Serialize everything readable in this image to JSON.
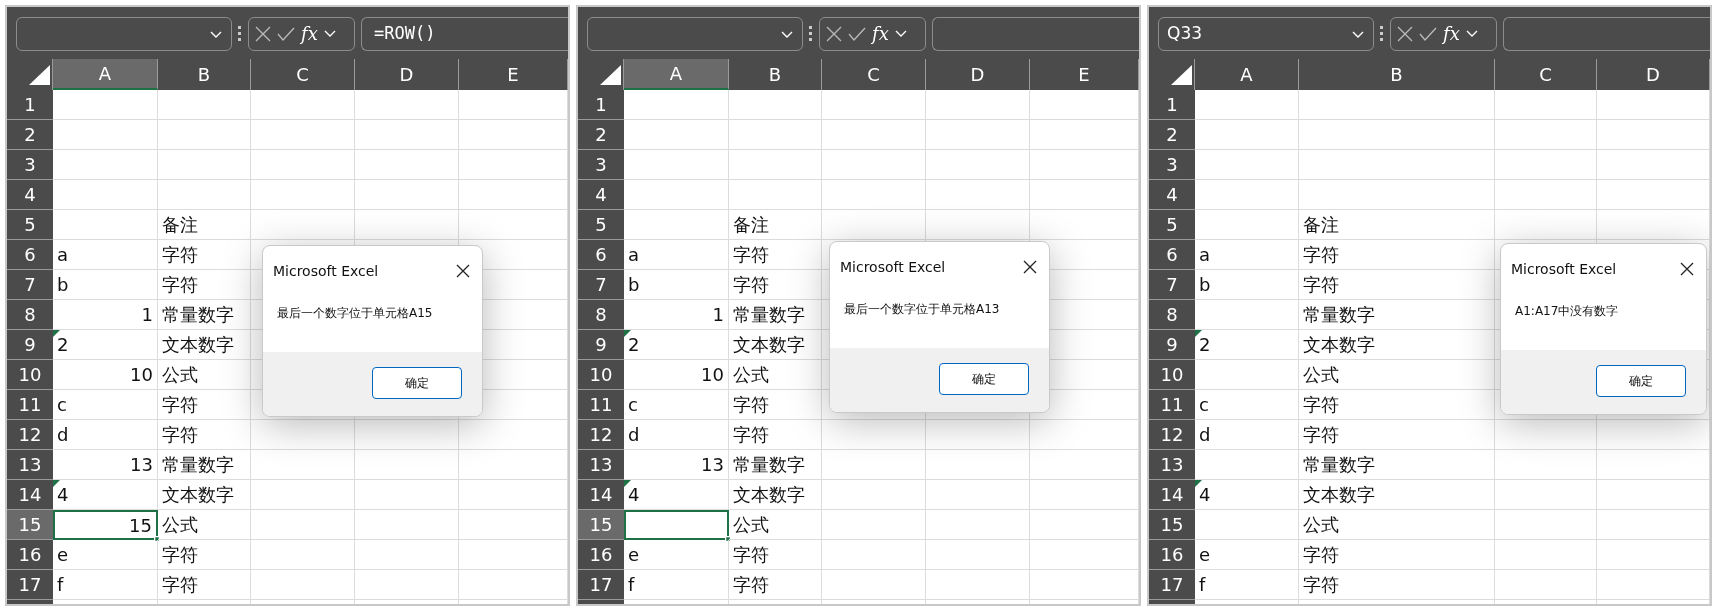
{
  "panels": [
    {
      "formula_bar": {
        "function_label": "fx",
        "formula": "=ROW()"
      },
      "columns": [
        {
          "label": "A",
          "selected": true
        },
        {
          "label": "B",
          "selected": false
        },
        {
          "label": "C",
          "selected": false
        },
        {
          "label": "D",
          "selected": false
        },
        {
          "label": "E",
          "selected": false
        }
      ],
      "rows": [
        {
          "label": "1",
          "selected": false
        },
        {
          "label": "2",
          "selected": false
        },
        {
          "label": "3",
          "selected": false
        },
        {
          "label": "4",
          "selected": false
        },
        {
          "label": "5",
          "selected": false,
          "cells": [
            {
              "selected": false
            },
            {
              "text": "备注",
              "kind": "text",
              "flagged": false,
              "selected": false
            }
          ]
        },
        {
          "label": "6",
          "selected": false,
          "cells": [
            {
              "text": "a",
              "kind": "text",
              "flagged": false,
              "selected": false
            },
            {
              "text": "字符",
              "kind": "text",
              "flagged": false,
              "selected": false
            }
          ]
        },
        {
          "label": "7",
          "selected": false,
          "cells": [
            {
              "text": "b",
              "kind": "text",
              "flagged": false,
              "selected": false
            },
            {
              "text": "字符",
              "kind": "text",
              "flagged": false,
              "selected": false
            }
          ]
        },
        {
          "label": "8",
          "selected": false,
          "cells": [
            {
              "text": "1",
              "kind": "number",
              "flagged": false,
              "selected": false
            },
            {
              "text": "常量数字",
              "kind": "text",
              "flagged": false,
              "selected": false
            }
          ]
        },
        {
          "label": "9",
          "selected": false,
          "cells": [
            {
              "text": "2",
              "kind": "text",
              "flagged": true,
              "selected": false
            },
            {
              "text": "文本数字",
              "kind": "text",
              "flagged": false,
              "selected": false
            }
          ]
        },
        {
          "label": "10",
          "selected": false,
          "cells": [
            {
              "text": "10",
              "kind": "number",
              "flagged": false,
              "selected": false
            },
            {
              "text": "公式",
              "kind": "text",
              "flagged": false,
              "selected": false
            }
          ]
        },
        {
          "label": "11",
          "selected": false,
          "cells": [
            {
              "text": "c",
              "kind": "text",
              "flagged": false,
              "selected": false
            },
            {
              "text": "字符",
              "kind": "text",
              "flagged": false,
              "selected": false
            }
          ]
        },
        {
          "label": "12",
          "selected": false,
          "cells": [
            {
              "text": "d",
              "kind": "text",
              "flagged": false,
              "selected": false
            },
            {
              "text": "字符",
              "kind": "text",
              "flagged": false,
              "selected": false
            }
          ]
        },
        {
          "label": "13",
          "selected": false,
          "cells": [
            {
              "text": "13",
              "kind": "number",
              "flagged": false,
              "selected": false
            },
            {
              "text": "常量数字",
              "kind": "text",
              "flagged": false,
              "selected": false
            }
          ]
        },
        {
          "label": "14",
          "selected": false,
          "cells": [
            {
              "text": "4",
              "kind": "text",
              "flagged": true,
              "selected": false
            },
            {
              "text": "文本数字",
              "kind": "text",
              "flagged": false,
              "selected": false
            }
          ]
        },
        {
          "label": "15",
          "selected": true,
          "cells": [
            {
              "text": "15",
              "kind": "number",
              "flagged": false,
              "selected": true
            },
            {
              "text": "公式",
              "kind": "text",
              "flagged": false,
              "selected": false
            }
          ]
        },
        {
          "label": "16",
          "selected": false,
          "cells": [
            {
              "text": "e",
              "kind": "text",
              "flagged": false,
              "selected": false
            },
            {
              "text": "字符",
              "kind": "text",
              "flagged": false,
              "selected": false
            }
          ]
        },
        {
          "label": "17",
          "selected": false,
          "cells": [
            {
              "text": "f",
              "kind": "text",
              "flagged": false,
              "selected": false
            },
            {
              "text": "字符",
              "kind": "text",
              "flagged": false,
              "selected": false
            }
          ]
        }
      ],
      "dialog": {
        "title": "Microsoft Excel",
        "message": "最后一个数字位于单元格A15",
        "button": "确定"
      }
    },
    {
      "formula_bar": {
        "function_label": "fx"
      },
      "columns": [
        {
          "label": "A",
          "selected": true
        },
        {
          "label": "B",
          "selected": false
        },
        {
          "label": "C",
          "selected": false
        },
        {
          "label": "D",
          "selected": false
        },
        {
          "label": "E",
          "selected": false
        }
      ],
      "rows": [
        {
          "label": "1",
          "selected": false
        },
        {
          "label": "2",
          "selected": false
        },
        {
          "label": "3",
          "selected": false
        },
        {
          "label": "4",
          "selected": false
        },
        {
          "label": "5",
          "selected": false,
          "cells": [
            {
              "selected": false
            },
            {
              "text": "备注",
              "kind": "text",
              "flagged": false,
              "selected": false
            }
          ]
        },
        {
          "label": "6",
          "selected": false,
          "cells": [
            {
              "text": "a",
              "kind": "text",
              "flagged": false,
              "selected": false
            },
            {
              "text": "字符",
              "kind": "text",
              "flagged": false,
              "selected": false
            }
          ]
        },
        {
          "label": "7",
          "selected": false,
          "cells": [
            {
              "text": "b",
              "kind": "text",
              "flagged": false,
              "selected": false
            },
            {
              "text": "字符",
              "kind": "text",
              "flagged": false,
              "selected": false
            }
          ]
        },
        {
          "label": "8",
          "selected": false,
          "cells": [
            {
              "text": "1",
              "kind": "number",
              "flagged": false,
              "selected": false
            },
            {
              "text": "常量数字",
              "kind": "text",
              "flagged": false,
              "selected": false
            }
          ]
        },
        {
          "label": "9",
          "selected": false,
          "cells": [
            {
              "text": "2",
              "kind": "text",
              "flagged": true,
              "selected": false
            },
            {
              "text": "文本数字",
              "kind": "text",
              "flagged": false,
              "selected": false
            }
          ]
        },
        {
          "label": "10",
          "selected": false,
          "cells": [
            {
              "text": "10",
              "kind": "number",
              "flagged": false,
              "selected": false
            },
            {
              "text": "公式",
              "kind": "text",
              "flagged": false,
              "selected": false
            }
          ]
        },
        {
          "label": "11",
          "selected": false,
          "cells": [
            {
              "text": "c",
              "kind": "text",
              "flagged": false,
              "selected": false
            },
            {
              "text": "字符",
              "kind": "text",
              "flagged": false,
              "selected": false
            }
          ]
        },
        {
          "label": "12",
          "selected": false,
          "cells": [
            {
              "text": "d",
              "kind": "text",
              "flagged": false,
              "selected": false
            },
            {
              "text": "字符",
              "kind": "text",
              "flagged": false,
              "selected": false
            }
          ]
        },
        {
          "label": "13",
          "selected": false,
          "cells": [
            {
              "text": "13",
              "kind": "number",
              "flagged": false,
              "selected": false
            },
            {
              "text": "常量数字",
              "kind": "text",
              "flagged": false,
              "selected": false
            }
          ]
        },
        {
          "label": "14",
          "selected": false,
          "cells": [
            {
              "text": "4",
              "kind": "text",
              "flagged": true,
              "selected": false
            },
            {
              "text": "文本数字",
              "kind": "text",
              "flagged": false,
              "selected": false
            }
          ]
        },
        {
          "label": "15",
          "selected": true,
          "cells": [
            {
              "selected": true
            },
            {
              "text": "公式",
              "kind": "text",
              "flagged": false,
              "selected": false
            }
          ]
        },
        {
          "label": "16",
          "selected": false,
          "cells": [
            {
              "text": "e",
              "kind": "text",
              "flagged": false,
              "selected": false
            },
            {
              "text": "字符",
              "kind": "text",
              "flagged": false,
              "selected": false
            }
          ]
        },
        {
          "label": "17",
          "selected": false,
          "cells": [
            {
              "text": "f",
              "kind": "text",
              "flagged": false,
              "selected": false
            },
            {
              "text": "字符",
              "kind": "text",
              "flagged": false,
              "selected": false
            }
          ]
        }
      ],
      "dialog": {
        "title": "Microsoft Excel",
        "message": "最后一个数字位于单元格A13",
        "button": "确定"
      }
    },
    {
      "formula_bar": {
        "name_box": "Q33",
        "function_label": "fx"
      },
      "columns": [
        {
          "label": "A",
          "selected": false
        },
        {
          "label": "B",
          "selected": false
        },
        {
          "label": "C",
          "selected": false
        },
        {
          "label": "D",
          "selected": false
        }
      ],
      "rows": [
        {
          "label": "1",
          "selected": false
        },
        {
          "label": "2",
          "selected": false
        },
        {
          "label": "3",
          "selected": false
        },
        {
          "label": "4",
          "selected": false
        },
        {
          "label": "5",
          "selected": false,
          "cells": [
            {
              "selected": false
            },
            {
              "text": "备注",
              "kind": "text",
              "flagged": false,
              "selected": false
            }
          ]
        },
        {
          "label": "6",
          "selected": false,
          "cells": [
            {
              "text": "a",
              "kind": "text",
              "flagged": false,
              "selected": false
            },
            {
              "text": "字符",
              "kind": "text",
              "flagged": false,
              "selected": false
            }
          ]
        },
        {
          "label": "7",
          "selected": false,
          "cells": [
            {
              "text": "b",
              "kind": "text",
              "flagged": false,
              "selected": false
            },
            {
              "text": "字符",
              "kind": "text",
              "flagged": false,
              "selected": false
            }
          ]
        },
        {
          "label": "8",
          "selected": false,
          "cells": [
            {
              "selected": false
            },
            {
              "text": "常量数字",
              "kind": "text",
              "flagged": false,
              "selected": false
            }
          ]
        },
        {
          "label": "9",
          "selected": false,
          "cells": [
            {
              "text": "2",
              "kind": "text",
              "flagged": true,
              "selected": false
            },
            {
              "text": "文本数字",
              "kind": "text",
              "flagged": false,
              "selected": false
            }
          ]
        },
        {
          "label": "10",
          "selected": false,
          "cells": [
            {
              "selected": false
            },
            {
              "text": "公式",
              "kind": "text",
              "flagged": false,
              "selected": false
            }
          ]
        },
        {
          "label": "11",
          "selected": false,
          "cells": [
            {
              "text": "c",
              "kind": "text",
              "flagged": false,
              "selected": false
            },
            {
              "text": "字符",
              "kind": "text",
              "flagged": false,
              "selected": false
            }
          ]
        },
        {
          "label": "12",
          "selected": false,
          "cells": [
            {
              "text": "d",
              "kind": "text",
              "flagged": false,
              "selected": false
            },
            {
              "text": "字符",
              "kind": "text",
              "flagged": false,
              "selected": false
            }
          ]
        },
        {
          "label": "13",
          "selected": false,
          "cells": [
            {
              "selected": false
            },
            {
              "text": "常量数字",
              "kind": "text",
              "flagged": false,
              "selected": false
            }
          ]
        },
        {
          "label": "14",
          "selected": false,
          "cells": [
            {
              "text": "4",
              "kind": "text",
              "flagged": true,
              "selected": false
            },
            {
              "text": "文本数字",
              "kind": "text",
              "flagged": false,
              "selected": false
            }
          ]
        },
        {
          "label": "15",
          "selected": false,
          "cells": [
            {
              "selected": false
            },
            {
              "text": "公式",
              "kind": "text",
              "flagged": false,
              "selected": false
            }
          ]
        },
        {
          "label": "16",
          "selected": false,
          "cells": [
            {
              "text": "e",
              "kind": "text",
              "flagged": false,
              "selected": false
            },
            {
              "text": "字符",
              "kind": "text",
              "flagged": false,
              "selected": false
            }
          ]
        },
        {
          "label": "17",
          "selected": false,
          "cells": [
            {
              "text": "f",
              "kind": "text",
              "flagged": false,
              "selected": false
            },
            {
              "text": "字符",
              "kind": "text",
              "flagged": false,
              "selected": false
            }
          ]
        }
      ],
      "dialog": {
        "title": "Microsoft Excel",
        "message": "A1:A17中没有数字",
        "button": "确定"
      }
    }
  ]
}
